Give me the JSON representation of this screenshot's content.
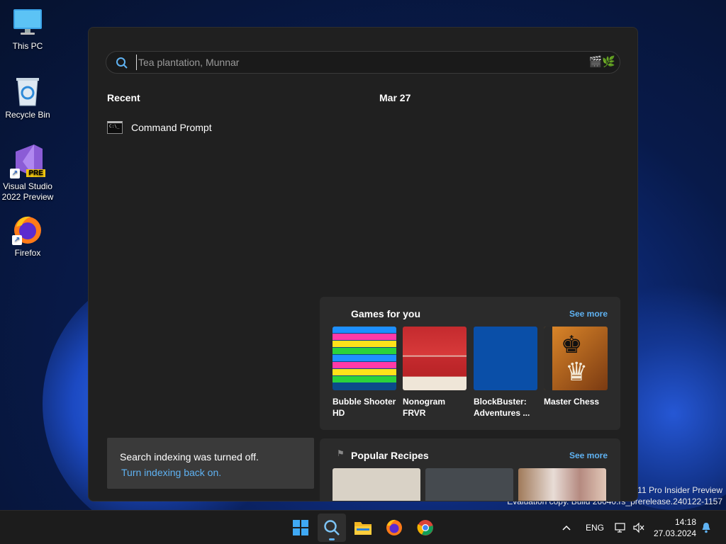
{
  "desktop": {
    "icons": [
      {
        "label": "This PC"
      },
      {
        "label": "Recycle Bin"
      },
      {
        "label": "Visual Studio 2022 Preview",
        "badge": "PRE"
      },
      {
        "label": "Firefox"
      }
    ],
    "watermark_line1": "s 11 Pro Insider Preview",
    "watermark_line2": "Evaluation copy. Build 26040.rs_prerelease.240122-1157"
  },
  "search": {
    "placeholder": "Tea plantation, Munnar",
    "recent_label": "Recent",
    "date_label": "Mar 27",
    "recent_items": [
      {
        "label": "Command Prompt"
      }
    ],
    "games": {
      "title": "Games for you",
      "see_more": "See more",
      "items": [
        {
          "name": "Bubble Shooter\nHD"
        },
        {
          "name": "Nonogram\nFRVR"
        },
        {
          "name": "BlockBuster:\nAdventures ..."
        },
        {
          "name": "Master Chess"
        }
      ]
    },
    "recipes": {
      "title": "Popular Recipes",
      "see_more": "See more"
    },
    "indexing": {
      "message": "Search indexing was turned off.",
      "link": "Turn indexing back on."
    }
  },
  "taskbar": {
    "language": "ENG",
    "time": "14:18",
    "date": "27.03.2024"
  },
  "colors": {
    "accent": "#5fb2f2",
    "panel": "#202020",
    "card": "#2b2b2b"
  }
}
